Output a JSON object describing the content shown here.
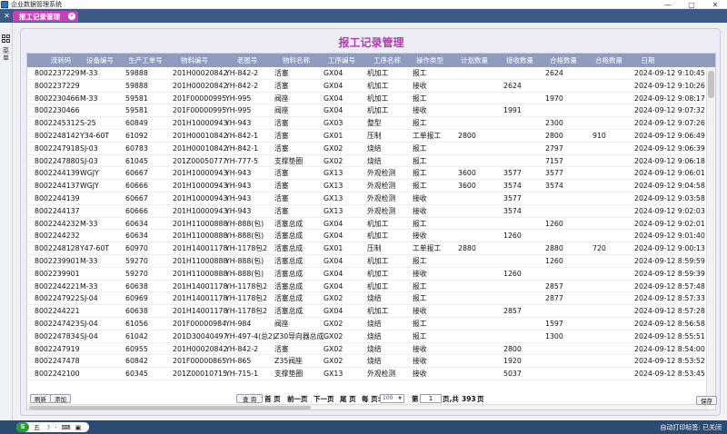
{
  "window": {
    "title": "企业数据管理系统",
    "controls": [
      "—",
      "▢",
      "✕"
    ]
  },
  "tab": {
    "label": "报工记录管理"
  },
  "sidebar": {
    "text": "菜单"
  },
  "page": {
    "title": "报工记录管理"
  },
  "columns": [
    "流转码",
    "设备编号",
    "生产工单号",
    "物料编号",
    "老图号",
    "物料名称",
    "工序编号",
    "工序名称",
    "操作类型",
    "计划数量",
    "接收数量",
    "合格数量",
    "合格数量",
    "日期"
  ],
  "rows": [
    [
      "8002237229",
      "M-33",
      "59888",
      "201H00020842",
      "YH-842-2",
      "活塞",
      "GX04",
      "机加工",
      "报工",
      "",
      "",
      "2624",
      "",
      "2024-09-12 9:10:45"
    ],
    [
      "8002237229",
      "",
      "59888",
      "201H00020842",
      "YH-842-2",
      "活塞",
      "GX04",
      "机加工",
      "接收",
      "",
      "2624",
      "",
      "",
      "2024-09-12 9:10:26"
    ],
    [
      "8002230466",
      "M-33",
      "59581",
      "201F00000995",
      "YH-995",
      "阀座",
      "GX04",
      "机加工",
      "报工",
      "",
      "",
      "1970",
      "",
      "2024-09-12 9:08:17"
    ],
    [
      "8002230466",
      "",
      "59581",
      "201F00000995",
      "YH-995",
      "阀座",
      "GX04",
      "机加工",
      "接收",
      "",
      "1991",
      "",
      "",
      "2024-09-12 9:07:32"
    ],
    [
      "8002245312",
      "S-25",
      "60849",
      "201H10000943",
      "YH-943",
      "活塞",
      "GX03",
      "整型",
      "报工",
      "",
      "",
      "2300",
      "",
      "2024-09-12 9:07:26"
    ],
    [
      "8002248142",
      "Y34-60T",
      "61092",
      "201H00010842",
      "YH-842-1",
      "活塞",
      "GX01",
      "压制",
      "工单报工",
      "2800",
      "",
      "2800",
      "910",
      "2024-09-12 9:06:49"
    ],
    [
      "8002247918",
      "SJ-03",
      "60783",
      "201H00010842",
      "YH-842-1",
      "活塞",
      "GX02",
      "烧结",
      "报工",
      "",
      "",
      "2797",
      "",
      "2024-09-12 9:06:39"
    ],
    [
      "8002247880",
      "SJ-03",
      "61045",
      "201Z00050777",
      "YH-777-5",
      "支撑垫圈",
      "GX02",
      "烧结",
      "报工",
      "",
      "",
      "7157",
      "",
      "2024-09-12 9:06:18"
    ],
    [
      "8002244139",
      "WGJY",
      "60667",
      "201H10000943",
      "YH-943",
      "活塞",
      "GX13",
      "外观检测",
      "报工",
      "3600",
      "3577",
      "3577",
      "",
      "2024-09-12 9:06:01"
    ],
    [
      "8002244137",
      "WGJY",
      "60666",
      "201H10000943",
      "YH-943",
      "活塞",
      "GX13",
      "外观检测",
      "报工",
      "3600",
      "3574",
      "3574",
      "",
      "2024-09-12 9:04:58"
    ],
    [
      "8002244139",
      "",
      "60667",
      "201H10000943",
      "YH-943",
      "活塞",
      "GX13",
      "外观检测",
      "接收",
      "",
      "3577",
      "",
      "",
      "2024-09-12 9:03:58"
    ],
    [
      "8002244137",
      "",
      "60666",
      "201H10000943",
      "YH-943",
      "活塞",
      "GX13",
      "外观检测",
      "接收",
      "",
      "3574",
      "",
      "",
      "2024-09-12 9:02:03"
    ],
    [
      "8002244232",
      "M-33",
      "60634",
      "201H11000888",
      "YH-888(包)",
      "活塞总成",
      "GX04",
      "机加工",
      "报工",
      "",
      "",
      "1260",
      "",
      "2024-09-12 9:02:01"
    ],
    [
      "8002244232",
      "",
      "60634",
      "201H11000888",
      "YH-888(包)",
      "活塞总成",
      "GX04",
      "机加工",
      "接收",
      "",
      "1260",
      "",
      "",
      "2024-09-12 9:01:40"
    ],
    [
      "8002248128",
      "Y47-60T",
      "60970",
      "201H14001178",
      "YH-1178包2",
      "活塞总成",
      "GX01",
      "压制",
      "工单报工",
      "2880",
      "",
      "2880",
      "720",
      "2024-09-12 9:00:13"
    ],
    [
      "8002239901",
      "M-33",
      "59270",
      "201H11000888",
      "YH-888(包)",
      "活塞总成",
      "GX04",
      "机加工",
      "报工",
      "",
      "",
      "1260",
      "",
      "2024-09-12 8:59:59"
    ],
    [
      "8002239901",
      "",
      "59270",
      "201H11000888",
      "YH-888(包)",
      "活塞总成",
      "GX04",
      "机加工",
      "接收",
      "",
      "1260",
      "",
      "",
      "2024-09-12 8:59:39"
    ],
    [
      "8002244221",
      "M-33",
      "60638",
      "201H14001178",
      "YH-1178包2",
      "活塞总成",
      "GX04",
      "机加工",
      "报工",
      "",
      "",
      "2857",
      "",
      "2024-09-12 8:57:48"
    ],
    [
      "8002247922",
      "SJ-04",
      "60969",
      "201H14001178",
      "YH-1178包2",
      "活塞总成",
      "GX02",
      "烧结",
      "报工",
      "",
      "",
      "2877",
      "",
      "2024-09-12 8:57:33"
    ],
    [
      "8002244221",
      "",
      "60638",
      "201H14001178",
      "YH-1178包2",
      "活塞总成",
      "GX04",
      "机加工",
      "接收",
      "",
      "2857",
      "",
      "",
      "2024-09-12 8:57:28"
    ],
    [
      "8002247423",
      "SJ-04",
      "61056",
      "201F00000984",
      "YH-984",
      "阀座",
      "GX02",
      "烧结",
      "报工",
      "",
      "",
      "1597",
      "",
      "2024-09-12 8:56:58"
    ],
    [
      "8002247834",
      "SJ-04",
      "61042",
      "201D30040497",
      "YH-497-4(总2)",
      "Z30导向器总成",
      "GX02",
      "烧结",
      "报工",
      "",
      "",
      "1300",
      "",
      "2024-09-12 8:55:51"
    ],
    [
      "8002247919",
      "",
      "60955",
      "201H00020842",
      "YH-842-2",
      "活塞",
      "GX02",
      "烧结",
      "接收",
      "",
      "2800",
      "",
      "",
      "2024-09-12 8:54:00"
    ],
    [
      "8002247478",
      "",
      "60842",
      "201F00000865",
      "YH-865",
      "Z35阀座",
      "GX02",
      "烧结",
      "接收",
      "",
      "1920",
      "",
      "",
      "2024-09-12 8:53:52"
    ],
    [
      "8002242100",
      "",
      "60345",
      "201Z00010715",
      "YH-715-1",
      "支撑垫圈",
      "GX13",
      "外观检测",
      "接收",
      "",
      "5037",
      "",
      "",
      "2024-09-12 8:53:45"
    ]
  ],
  "toolbar": {
    "refresh": "刷新",
    "add": "添加",
    "save": "保存"
  },
  "pager": {
    "query": "查 询",
    "first": "首 页",
    "prev": "前一页",
    "next": "下一页",
    "last": "尾 页",
    "per_page_label": "每 页:",
    "per_page": "100",
    "page_prefix": "第",
    "page": "1",
    "total_prefix": "页,共",
    "total": "393",
    "total_suffix": "页"
  },
  "taskbar": {
    "ime": [
      "五",
      "☽",
      "·",
      "⌨",
      "▣"
    ],
    "status": "自动打印标签: 已关闭"
  },
  "colors": {
    "accent": "#b23cb0",
    "tab": "#c542b5",
    "header": "#8f9cc0",
    "taskbar": "#2c4b73"
  }
}
